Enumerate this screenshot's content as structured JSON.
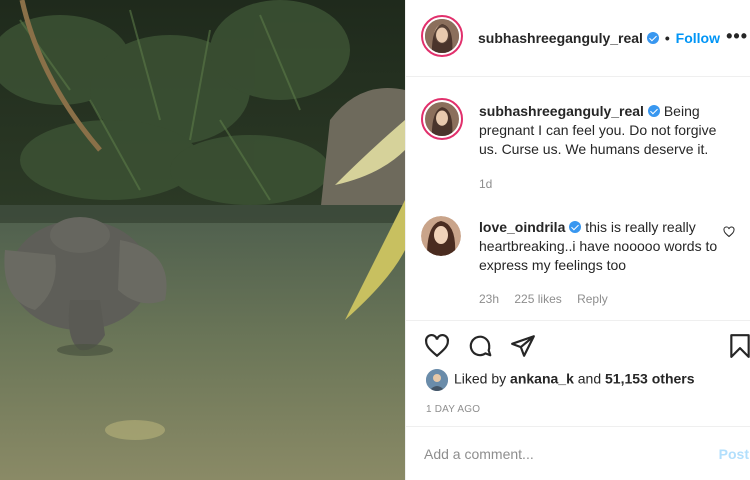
{
  "post": {
    "author": "subhashreeganguly_real",
    "separator": "•",
    "follow_label": "Follow",
    "more_icon": "more-horizontal-icon"
  },
  "comments": [
    {
      "username": "subhashreeganguly_real",
      "verified": true,
      "text": "Being pregnant I can feel you. Do not forgive us. Curse us. We humans deserve it.",
      "time": "1d"
    },
    {
      "username": "love_oindrila",
      "verified": true,
      "text": "this is really really heartbreaking..i have nooooo words to express my feelings too",
      "time": "23h",
      "likes": "225 likes",
      "reply_label": "Reply"
    }
  ],
  "actions": {
    "icons": [
      "heart-icon",
      "comment-icon",
      "share-icon",
      "bookmark-icon"
    ]
  },
  "likes": {
    "prefix": "Liked by",
    "user": "ankana_k",
    "conjunction": "and",
    "others": "51,153 others"
  },
  "timestamp": "1 DAY AGO",
  "add_comment": {
    "placeholder": "Add a comment...",
    "post_label": "Post"
  },
  "colors": {
    "link": "#0095f6",
    "verified": "#3897f0",
    "muted": "#8e8e8e",
    "story_ring": "#e1306c"
  }
}
